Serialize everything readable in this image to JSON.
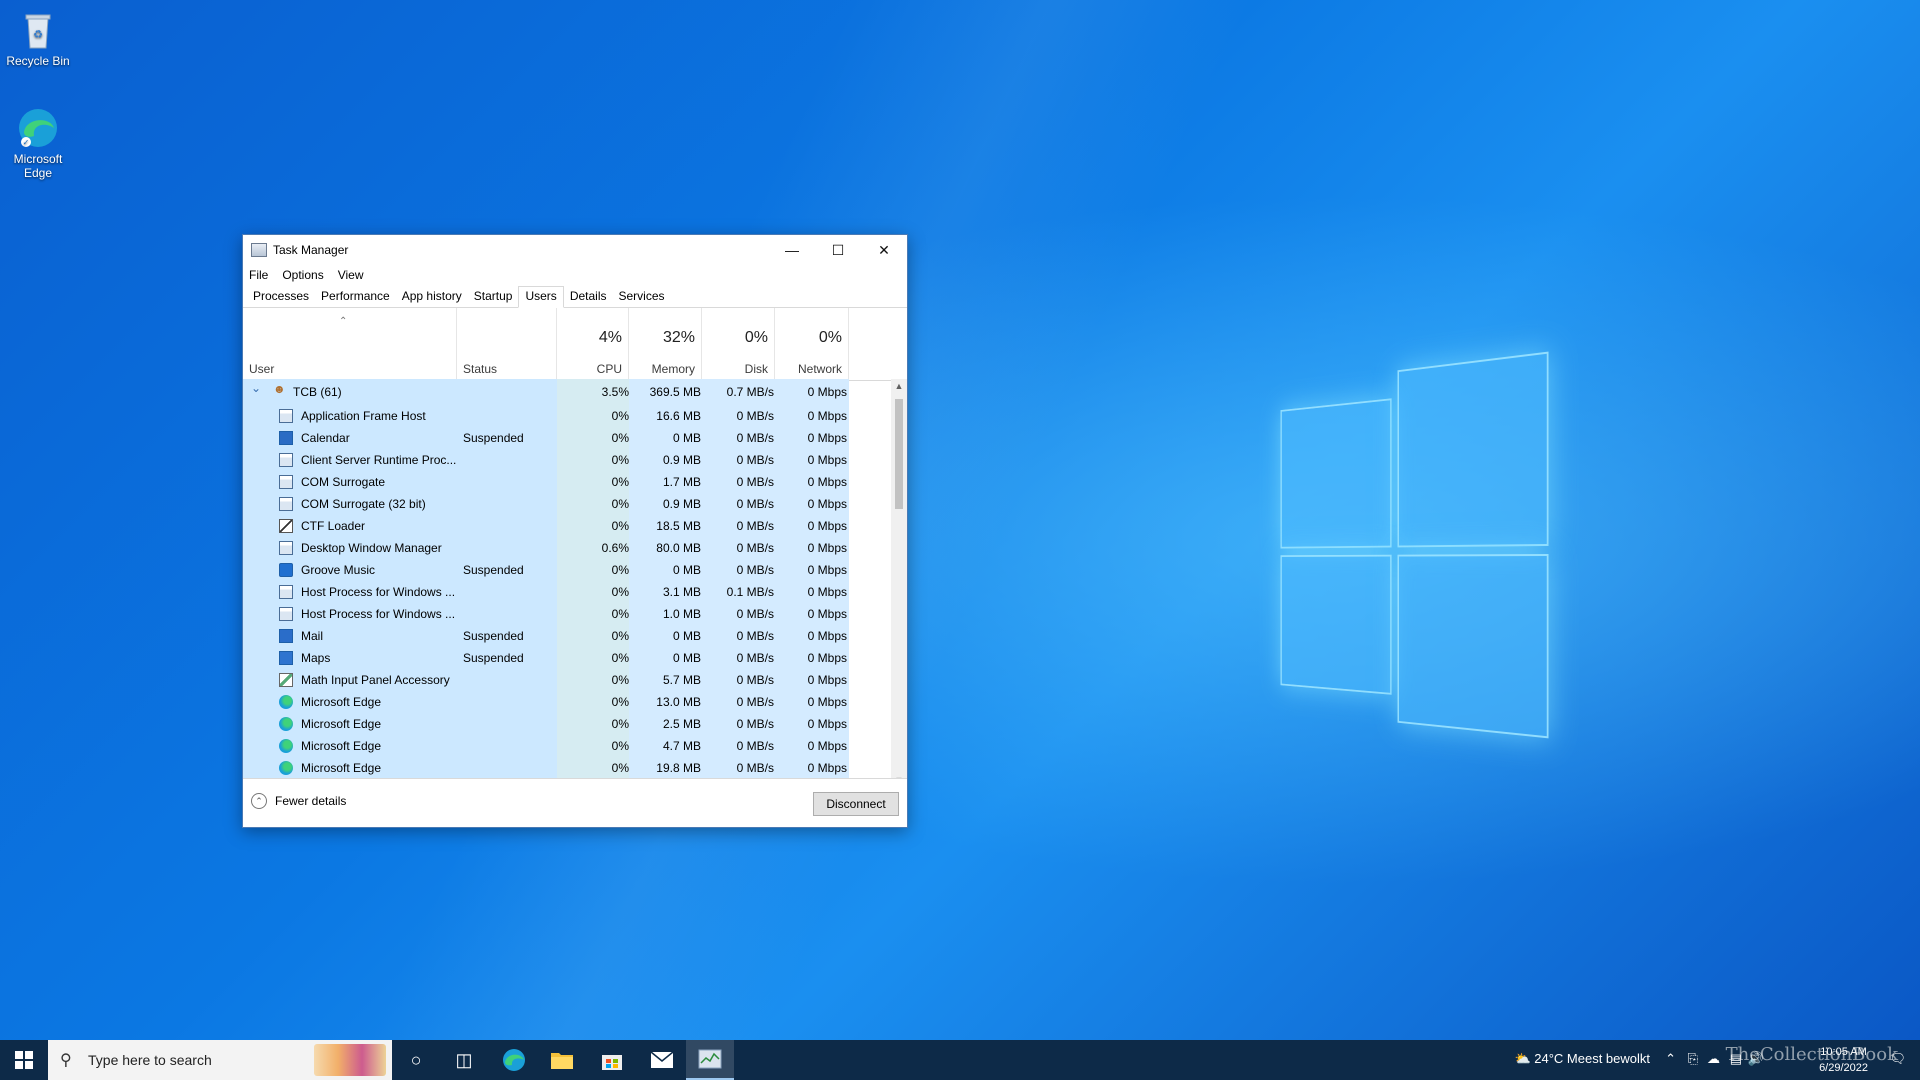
{
  "desktop": {
    "icons": [
      {
        "label": "Recycle Bin"
      },
      {
        "label": "Microsoft Edge"
      }
    ]
  },
  "window": {
    "title": "Task Manager",
    "menu": [
      "File",
      "Options",
      "View"
    ],
    "tabs": [
      "Processes",
      "Performance",
      "App history",
      "Startup",
      "Users",
      "Details",
      "Services"
    ],
    "active_tab": "Users",
    "columns": {
      "user": "User",
      "status": "Status",
      "cpu": {
        "pct": "4%",
        "label": "CPU"
      },
      "memory": {
        "pct": "32%",
        "label": "Memory"
      },
      "disk": {
        "pct": "0%",
        "label": "Disk"
      },
      "network": {
        "pct": "0%",
        "label": "Network"
      }
    },
    "user_row": {
      "name": "TCB (61)",
      "cpu": "3.5%",
      "memory": "369.5 MB",
      "disk": "0.7 MB/s",
      "network": "0 Mbps"
    },
    "rows": [
      {
        "name": "Application Frame Host",
        "status": "",
        "cpu": "0%",
        "memory": "16.6 MB",
        "disk": "0 MB/s",
        "network": "0 Mbps",
        "icon": "app-window-icon"
      },
      {
        "name": "Calendar",
        "status": "Suspended",
        "cpu": "0%",
        "memory": "0 MB",
        "disk": "0 MB/s",
        "network": "0 Mbps",
        "icon": "calendar-icon"
      },
      {
        "name": "Client Server Runtime Proc...",
        "status": "",
        "cpu": "0%",
        "memory": "0.9 MB",
        "disk": "0 MB/s",
        "network": "0 Mbps",
        "icon": "app-window-icon"
      },
      {
        "name": "COM Surrogate",
        "status": "",
        "cpu": "0%",
        "memory": "1.7 MB",
        "disk": "0 MB/s",
        "network": "0 Mbps",
        "icon": "app-window-icon"
      },
      {
        "name": "COM Surrogate (32 bit)",
        "status": "",
        "cpu": "0%",
        "memory": "0.9 MB",
        "disk": "0 MB/s",
        "network": "0 Mbps",
        "icon": "app-window-icon"
      },
      {
        "name": "CTF Loader",
        "status": "",
        "cpu": "0%",
        "memory": "18.5 MB",
        "disk": "0 MB/s",
        "network": "0 Mbps",
        "icon": "pen-icon"
      },
      {
        "name": "Desktop Window Manager",
        "status": "",
        "cpu": "0.6%",
        "memory": "80.0 MB",
        "disk": "0 MB/s",
        "network": "0 Mbps",
        "icon": "app-window-icon"
      },
      {
        "name": "Groove Music",
        "status": "Suspended",
        "cpu": "0%",
        "memory": "0 MB",
        "disk": "0 MB/s",
        "network": "0 Mbps",
        "icon": "music-icon"
      },
      {
        "name": "Host Process for Windows ...",
        "status": "",
        "cpu": "0%",
        "memory": "3.1 MB",
        "disk": "0.1 MB/s",
        "network": "0 Mbps",
        "icon": "app-window-icon"
      },
      {
        "name": "Host Process for Windows ...",
        "status": "",
        "cpu": "0%",
        "memory": "1.0 MB",
        "disk": "0 MB/s",
        "network": "0 Mbps",
        "icon": "app-window-icon"
      },
      {
        "name": "Mail",
        "status": "Suspended",
        "cpu": "0%",
        "memory": "0 MB",
        "disk": "0 MB/s",
        "network": "0 Mbps",
        "icon": "mail-icon"
      },
      {
        "name": "Maps",
        "status": "Suspended",
        "cpu": "0%",
        "memory": "0 MB",
        "disk": "0 MB/s",
        "network": "0 Mbps",
        "icon": "map-pin-icon"
      },
      {
        "name": "Math Input Panel Accessory",
        "status": "",
        "cpu": "0%",
        "memory": "5.7 MB",
        "disk": "0 MB/s",
        "network": "0 Mbps",
        "icon": "math-pen-icon"
      },
      {
        "name": "Microsoft Edge",
        "status": "",
        "cpu": "0%",
        "memory": "13.0 MB",
        "disk": "0 MB/s",
        "network": "0 Mbps",
        "icon": "edge-icon"
      },
      {
        "name": "Microsoft Edge",
        "status": "",
        "cpu": "0%",
        "memory": "2.5 MB",
        "disk": "0 MB/s",
        "network": "0 Mbps",
        "icon": "edge-icon"
      },
      {
        "name": "Microsoft Edge",
        "status": "",
        "cpu": "0%",
        "memory": "4.7 MB",
        "disk": "0 MB/s",
        "network": "0 Mbps",
        "icon": "edge-icon"
      },
      {
        "name": "Microsoft Edge",
        "status": "",
        "cpu": "0%",
        "memory": "19.8 MB",
        "disk": "0 MB/s",
        "network": "0 Mbps",
        "icon": "edge-icon"
      }
    ],
    "footer": {
      "fewer_details": "Fewer details",
      "disconnect": "Disconnect"
    }
  },
  "taskbar": {
    "search_placeholder": "Type here to search",
    "weather": "24°C  Meest bewolkt",
    "time": "10:05 AM",
    "date": "6/29/2022"
  },
  "watermark": "TheCollectionBook",
  "colors": {
    "selection": "#cce8ff",
    "accent": "#0078d7"
  }
}
